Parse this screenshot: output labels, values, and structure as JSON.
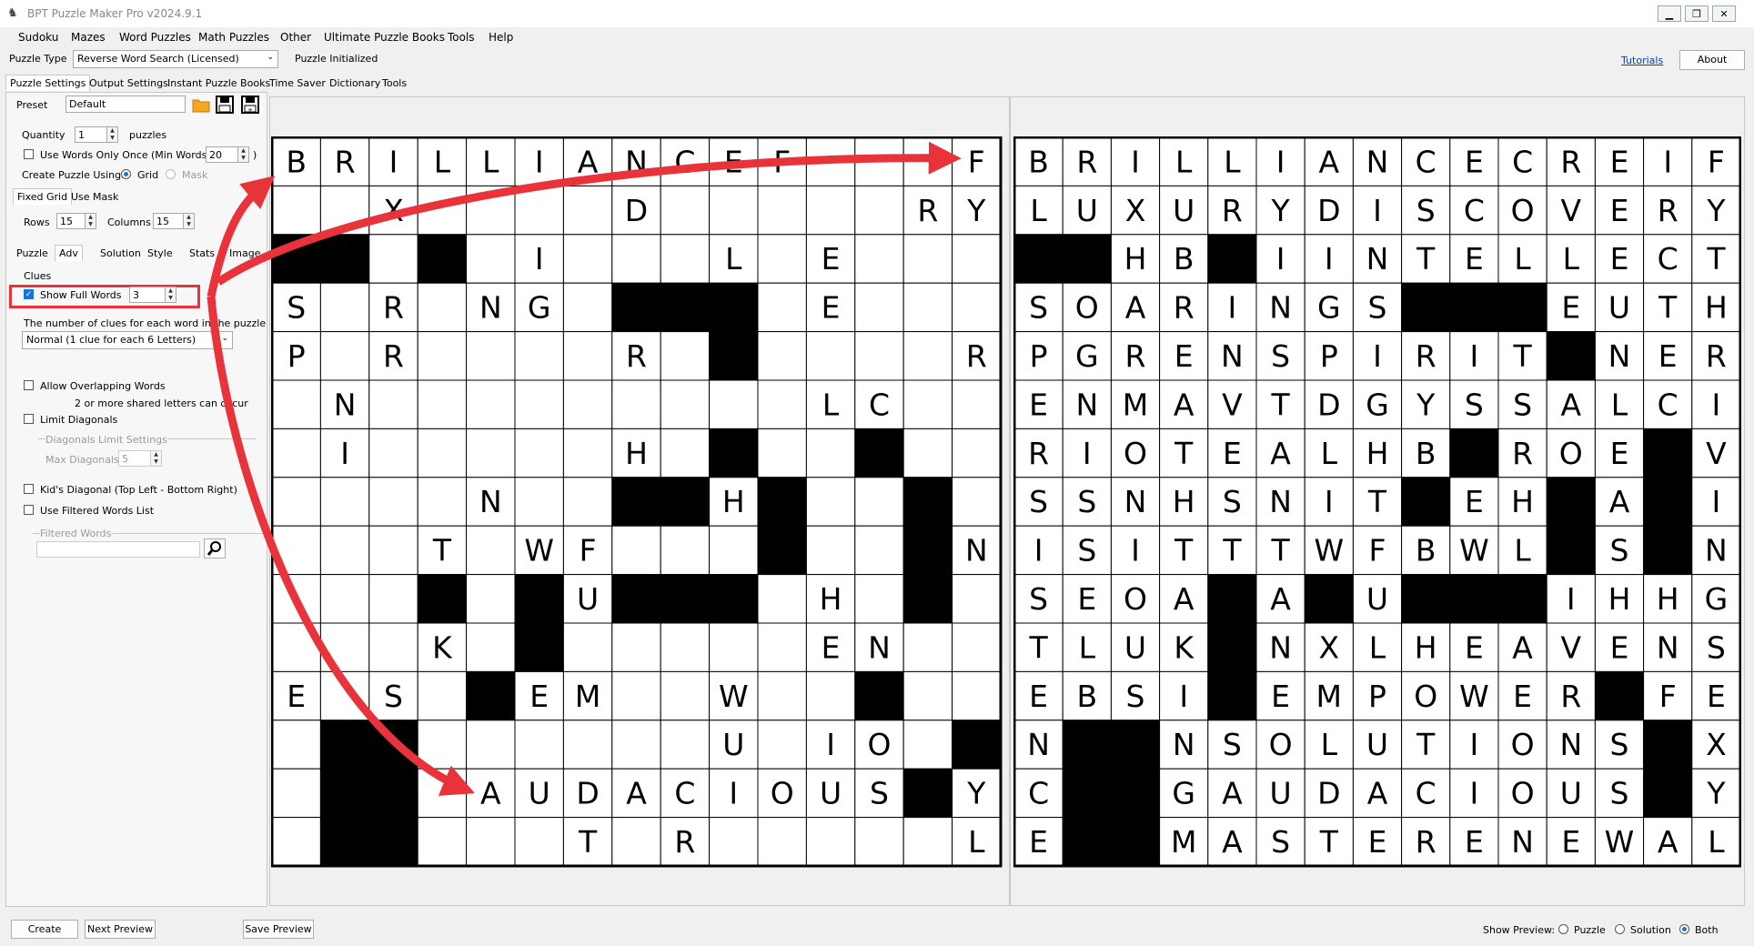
{
  "window": {
    "title": "BPT Puzzle Maker Pro v2024.9.1"
  },
  "menu": [
    "Sudoku",
    "Mazes",
    "Word Puzzles",
    "Math Puzzles",
    "Other",
    "Ultimate Puzzle Books",
    "Tools",
    "Help"
  ],
  "toolbar": {
    "puzzle_type_label": "Puzzle Type",
    "puzzle_type_value": "Reverse Word Search (Licensed)",
    "status": "Puzzle Initialized",
    "tutorials_link": "Tutorials",
    "about_button": "About"
  },
  "main_tabs": [
    "Puzzle Settings",
    "Output Settings",
    "Instant Puzzle Books",
    "Time Saver",
    "Dictionary",
    "Tools"
  ],
  "settings": {
    "preset_label": "Preset",
    "preset_value": "Default",
    "quantity_label": "Quantity",
    "quantity_value": "1",
    "quantity_unit": "puzzles",
    "use_words_once_label": "Use Words Only Once",
    "min_words_label": "(Min Words:",
    "min_words_value": "20",
    "min_words_close": ")",
    "create_using_label": "Create Puzzle Using:",
    "grid_option": "Grid",
    "mask_option": "Mask",
    "grid_tabs": [
      "Fixed Grid",
      "Use Mask"
    ],
    "rows_label": "Rows",
    "rows_value": "15",
    "columns_label": "Columns",
    "columns_value": "15",
    "sub_tabs": [
      "Puzzle",
      "Adv",
      "Solution",
      "Style",
      "Stats",
      "Image"
    ],
    "clues_label": "Clues",
    "show_full_words_label": "Show Full Words",
    "show_full_words_value": "3",
    "clues_desc": "The number of clues for each word in the puzzle",
    "clues_combo": "Normal (1 clue for each 6 Letters)",
    "allow_overlap_label": "Allow Overlapping Words",
    "overlap_desc": "2 or more shared letters can occur",
    "limit_diagonals_label": "Limit Diagonals",
    "diag_group_label": "Diagonals Limit Settings",
    "max_diagonals_label": "Max Diagonals",
    "max_diagonals_value": "5",
    "kids_diagonal_label": "Kid's Diagonal (Top Left - Bottom Right)",
    "filtered_list_label": "Use Filtered Words List",
    "filtered_words_label": "Filtered Words",
    "filtered_words_value": ""
  },
  "bottom": {
    "create_button": "Create",
    "next_preview_button": "Next Preview",
    "save_preview_button": "Save Preview",
    "show_preview_label": "Show Preview:",
    "preview_options": [
      "Puzzle",
      "Solution",
      "Both"
    ],
    "preview_selected": "Both"
  },
  "puzzle_grid": [
    "BRILLIANCEF...F",
    "..X....D.....RY",
    "##.#.I...L.E...",
    "S.R.NG.###.E...",
    "P.R....R.#....R",
    ".N.........LC..",
    ".I.....H.#..#..",
    "....N..##H#..#.",
    "...T.WF...#..#N",
    "...#.#U###.H.#.",
    "...K.#.....EN..",
    "E.S.#EM..W..#..",
    ".##......U.IO.#",
    ".##.AUDACIOUS#Y",
    ".##...T.R.....L"
  ],
  "solution_grid": [
    "BRILLIANCECREIF",
    "LUXURYDISCOVERY",
    "##HB#IINTELLECT",
    "SOARINGS###EUTH",
    "PGRENSPIRIT#NER",
    "ENMAVTDGYSSALCI",
    "RIOTEALHB#ROE#V",
    "SSNHSNIT#EH#A#I",
    "ISITTTWFBWL#S#N",
    "SEOA#A#U###IHHG",
    "TLUK#NXLHEAVENS",
    "EBSI#EMPOWER#FE",
    "N##NSOLUTIONS#X",
    "C##GAUDACIOUS#Y",
    "E##MASTERENEWAL"
  ],
  "colors": {
    "accent": "#1a73d6",
    "highlight": "#e8333a",
    "link": "#0a3ea8"
  }
}
